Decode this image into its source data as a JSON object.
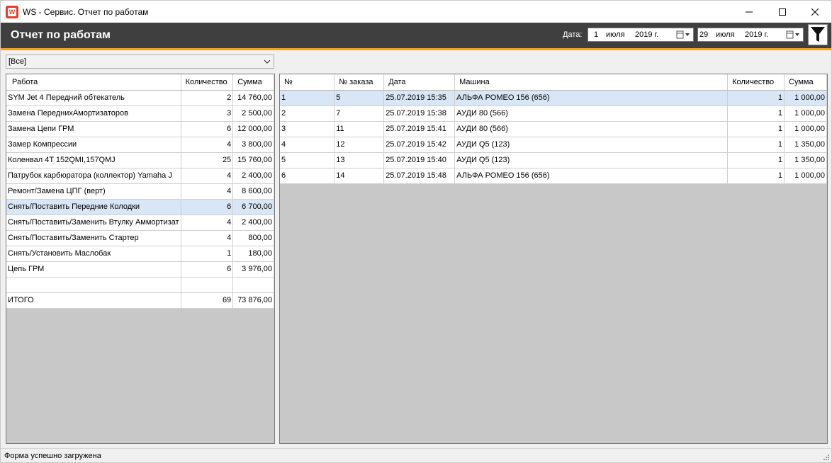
{
  "window": {
    "title": "WS - Сервис. Отчет по работам",
    "icon": "ws-logo-icon"
  },
  "header": {
    "title": "Отчет по работам",
    "date_label": "Дата:",
    "date_from": {
      "day": "1",
      "month": "июля",
      "year": "2019 г."
    },
    "date_to": {
      "day": "29",
      "month": "июля",
      "year": "2019 г."
    }
  },
  "filter": {
    "combo_value": "[Все]"
  },
  "left_table": {
    "columns": [
      "Работа",
      "Количество",
      "Сумма"
    ],
    "rows": [
      {
        "name": "SYM Jet 4 Передний обтекатель",
        "qty": "2",
        "sum": "14 760,00"
      },
      {
        "name": "Замена ПереднихАмортизаторов",
        "qty": "3",
        "sum": "2 500,00"
      },
      {
        "name": "Замена Цепи ГРМ",
        "qty": "6",
        "sum": "12 000,00"
      },
      {
        "name": "Замер Компрессии",
        "qty": "4",
        "sum": "3 800,00"
      },
      {
        "name": "Коленвал 4T 152QMI,157QMJ",
        "qty": "25",
        "sum": "15 760,00"
      },
      {
        "name": "Патрубок карбюратора (коллектор)  Yamaha J",
        "qty": "4",
        "sum": "2 400,00"
      },
      {
        "name": "Ремонт/Замена ЦПГ (верт)",
        "qty": "4",
        "sum": "8 600,00"
      },
      {
        "name": "Снять/Поставить Передние Колодки",
        "qty": "6",
        "sum": "6 700,00"
      },
      {
        "name": "Снять/Поставить/Заменить Втулку Аммортизат",
        "qty": "4",
        "sum": "2 400,00"
      },
      {
        "name": "Снять/Поставить/Заменить Стартер",
        "qty": "4",
        "sum": "800,00"
      },
      {
        "name": "Снять/Установить Маслобак",
        "qty": "1",
        "sum": "180,00"
      },
      {
        "name": "Цепь ГРМ",
        "qty": "6",
        "sum": "3 976,00"
      },
      {
        "name": "",
        "qty": "",
        "sum": ""
      },
      {
        "name": "ИТОГО",
        "qty": "69",
        "sum": "73 876,00"
      }
    ]
  },
  "right_table": {
    "columns": [
      "№",
      "№ заказа",
      "Дата",
      "Машина",
      "Количество",
      "Сумма"
    ],
    "rows": [
      {
        "n": "1",
        "order": "5",
        "date": "25.07.2019 15:35",
        "car": "АЛЬФА РОМЕО 156 (656)",
        "qty": "1",
        "sum": "1 000,00"
      },
      {
        "n": "2",
        "order": "7",
        "date": "25.07.2019 15:38",
        "car": "АУДИ 80 (566)",
        "qty": "1",
        "sum": "1 000,00"
      },
      {
        "n": "3",
        "order": "11",
        "date": "25.07.2019 15:41",
        "car": "АУДИ 80 (566)",
        "qty": "1",
        "sum": "1 000,00"
      },
      {
        "n": "4",
        "order": "12",
        "date": "25.07.2019 15:42",
        "car": "АУДИ Q5 (123)",
        "qty": "1",
        "sum": "1 350,00"
      },
      {
        "n": "5",
        "order": "13",
        "date": "25.07.2019 15:40",
        "car": "АУДИ Q5 (123)",
        "qty": "1",
        "sum": "1 350,00"
      },
      {
        "n": "6",
        "order": "14",
        "date": "25.07.2019 15:48",
        "car": "АЛЬФА РОМЕО 156 (656)",
        "qty": "1",
        "sum": "1 000,00"
      }
    ]
  },
  "status": {
    "text": "Форма успешно загружена"
  },
  "colors": {
    "header_bg": "#3f3f3f",
    "accent_stripe": "#f0a21a",
    "selected_row": "#d9e6f5",
    "app_icon": "#e33d2b"
  }
}
